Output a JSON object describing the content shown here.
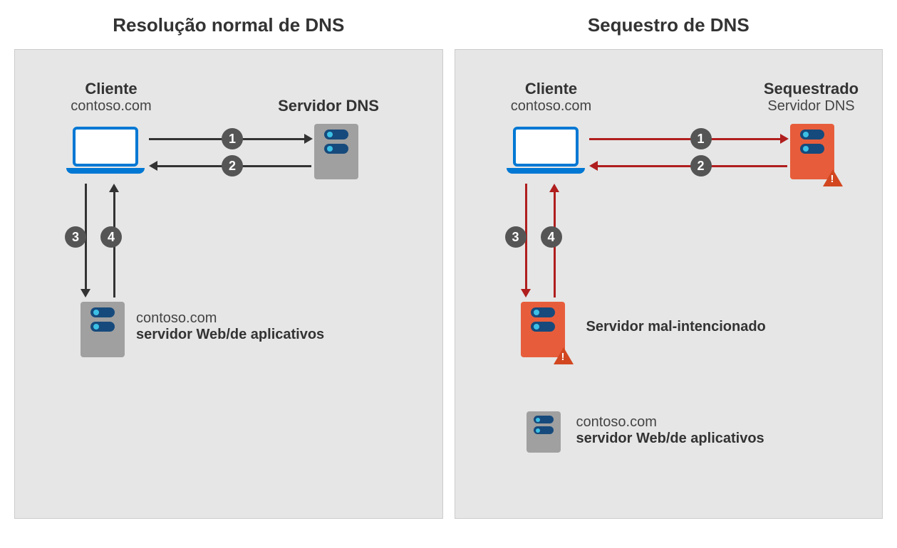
{
  "left": {
    "title": "Resolução normal de DNS",
    "client_bold": "Cliente",
    "client_sub": "contoso.com",
    "dns_label": "Servidor DNS",
    "web_l1": "contoso.com",
    "web_l2": "servidor Web/de aplicativos",
    "steps": {
      "s1": "1",
      "s2": "2",
      "s3": "3",
      "s4": "4"
    }
  },
  "right": {
    "title": "Sequestro de DNS",
    "client_bold": "Cliente",
    "client_sub": "contoso.com",
    "dns_bold": "Sequestrado",
    "dns_sub": "Servidor DNS",
    "mal_label": "Servidor mal-intencionado",
    "web_l1": "contoso.com",
    "web_l2": "servidor Web/de aplicativos",
    "steps": {
      "s1": "1",
      "s2": "2",
      "s3": "3",
      "s4": "4"
    }
  }
}
